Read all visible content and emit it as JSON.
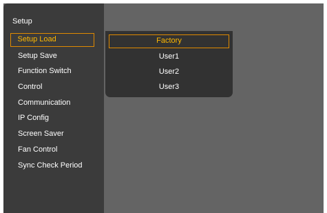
{
  "panel": {
    "title": "Setup"
  },
  "menu": {
    "items": [
      {
        "label": "Setup Load",
        "selected": true
      },
      {
        "label": "Setup Save"
      },
      {
        "label": "Function Switch"
      },
      {
        "label": "Control"
      },
      {
        "label": "Communication"
      },
      {
        "label": "IP Config"
      },
      {
        "label": "Screen Saver"
      },
      {
        "label": "Fan Control"
      },
      {
        "label": "Sync Check Period"
      }
    ]
  },
  "submenu": {
    "items": [
      {
        "label": "Factory",
        "selected": true
      },
      {
        "label": "User1"
      },
      {
        "label": "User2"
      },
      {
        "label": "User3"
      }
    ]
  },
  "colors": {
    "highlight_text": "#ffb800",
    "highlight_border": "#e08a00",
    "panel_bg": "#3b3b3b",
    "screen_bg": "#646464"
  }
}
